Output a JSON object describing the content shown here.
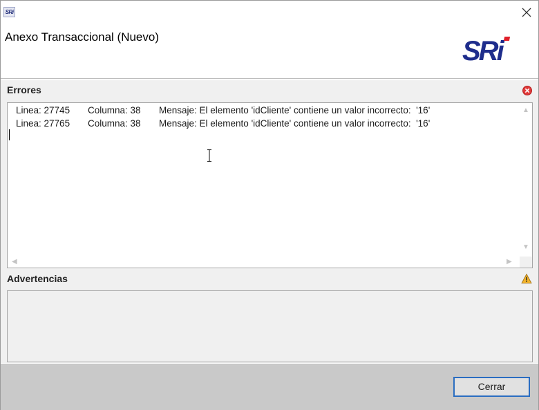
{
  "window": {
    "app_icon_text": "SRi",
    "title": "Anexo Transaccional (Nuevo)",
    "logo_text": "SRi",
    "close_icon": "close-x-icon"
  },
  "errors": {
    "label": "Errores",
    "icon": "error-circle-icon",
    "rows": [
      {
        "linea": "Linea: 27745",
        "columna": "Columna: 38",
        "mensaje": "Mensaje: El elemento 'idCliente' contiene un valor incorrecto:  '16'"
      },
      {
        "linea": "Linea: 27765",
        "columna": "Columna: 38",
        "mensaje": "Mensaje: El elemento 'idCliente' contiene un valor incorrecto:  '16'"
      }
    ]
  },
  "warnings": {
    "label": "Advertencias",
    "icon": "warning-triangle-icon"
  },
  "footer": {
    "close_label": "Cerrar"
  },
  "colors": {
    "button_border": "#2a6dc1",
    "logo_blue": "#1e2d8c",
    "logo_red": "#e0202a",
    "error_red": "#e03a3a",
    "warning_yellow": "#f2b32a"
  }
}
